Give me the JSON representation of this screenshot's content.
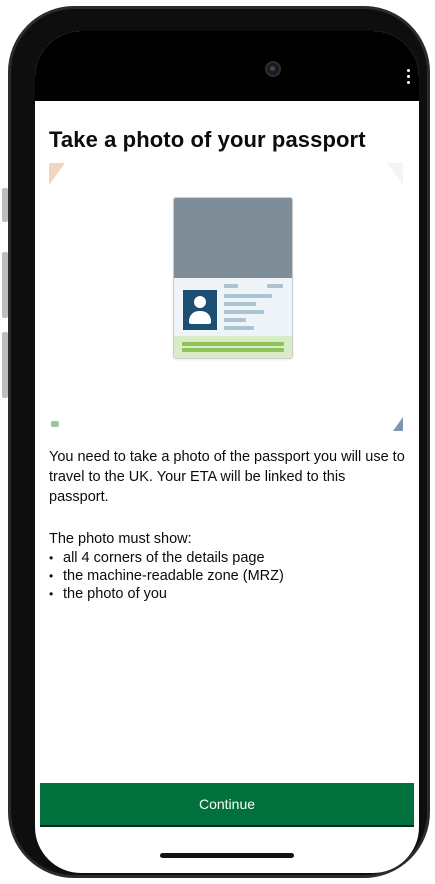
{
  "screen": {
    "title": "Take a photo of your passport",
    "intro": "You need to take a photo of the passport you will use to travel to the UK. Your ETA will be linked to this passport.",
    "requirements_title": "The photo must show:",
    "requirements": [
      "all 4 corners of the details page",
      "the machine-readable zone (MRZ)",
      "the photo of you"
    ],
    "continue_label": "Continue"
  },
  "icons": {
    "menu": "more-vertical-icon",
    "camera": "front-camera"
  },
  "colors": {
    "primary_button": "#00703c",
    "text": "#0b0c0c",
    "passport_cover": "#7f8d98",
    "photo_box": "#1d4f73",
    "mrz_band": "#8dc35a"
  }
}
